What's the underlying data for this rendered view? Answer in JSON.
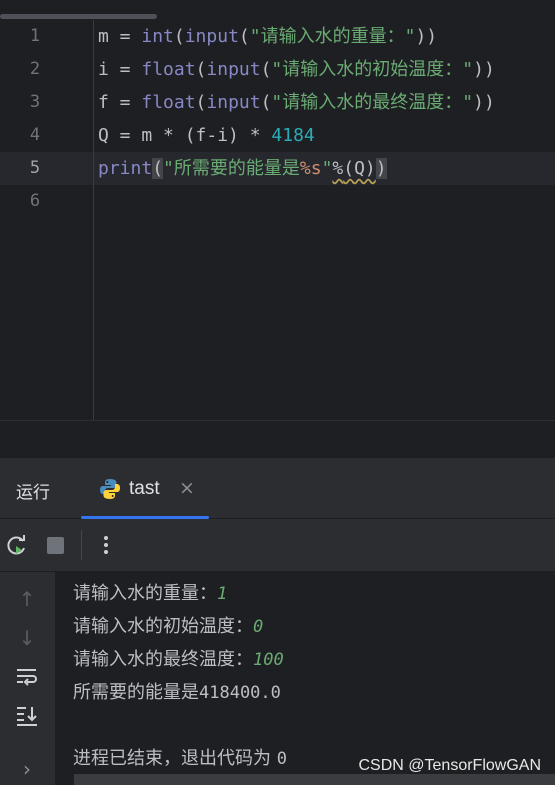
{
  "editor": {
    "lines": [
      {
        "num": "1"
      },
      {
        "num": "2"
      },
      {
        "num": "3"
      },
      {
        "num": "4"
      },
      {
        "num": "5"
      },
      {
        "num": "6"
      }
    ],
    "code": {
      "l1": {
        "var": "m = ",
        "fn1": "int",
        "p1": "(",
        "fn2": "input",
        "p2": "(",
        "str": "\"请输入水的重量：\"",
        "close": "))"
      },
      "l2": {
        "var": "i = ",
        "fn1": "float",
        "p1": "(",
        "fn2": "input",
        "p2": "(",
        "str": "\"请输入水的初始温度：\"",
        "close": "))"
      },
      "l3": {
        "var": "f = ",
        "fn1": "float",
        "p1": "(",
        "fn2": "input",
        "p2": "(",
        "str": "\"请输入水的最终温度：\"",
        "close": "))"
      },
      "l4": {
        "expr": "Q = m * (f-i) * ",
        "num": "4184"
      },
      "l5": {
        "fn": "print",
        "open": "(",
        "str_a": "\"所需要的能量是",
        "fmt": "%s",
        "str_b": "\"",
        "op": "%",
        "arg": "(Q)",
        "close": ")"
      }
    }
  },
  "panel": {
    "run_label": "运行",
    "tab_label": "tast",
    "tab_close": "×",
    "accent": "#3574f0"
  },
  "toolbar": {
    "rerun_icon": "rerun-icon",
    "stop_icon": "stop-icon",
    "more_icon": "more-vertical-icon"
  },
  "side": {
    "up": "↑",
    "down": "↓",
    "chevron": "›"
  },
  "console": {
    "l1_prompt": "请输入水的重量：",
    "l1_input": "1",
    "l2_prompt": "请输入水的初始温度：",
    "l2_input": "0",
    "l3_prompt": "请输入水的最终温度：",
    "l3_input": "100",
    "l4_text": "所需要的能量是",
    "l4_value": "418400.0",
    "l5_text": "进程已结束，退出代码为 ",
    "l5_code": "0"
  },
  "watermark": "CSDN @TensorFlowGAN"
}
